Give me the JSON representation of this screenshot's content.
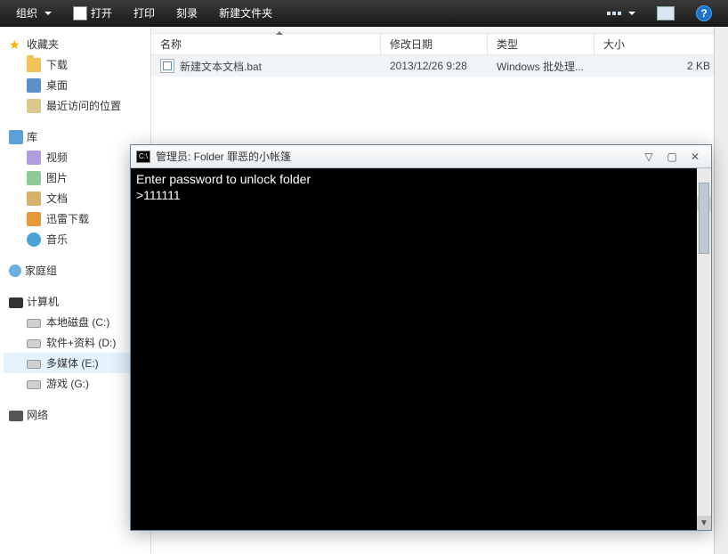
{
  "toolbar": {
    "organize": "组织",
    "open": "打开",
    "print": "打印",
    "burn": "刻录",
    "newfolder": "新建文件夹"
  },
  "sidebar": {
    "favorites": {
      "label": "收藏夹",
      "items": [
        {
          "label": "下载"
        },
        {
          "label": "桌面"
        },
        {
          "label": "最近访问的位置"
        }
      ]
    },
    "libraries": {
      "label": "库",
      "items": [
        {
          "label": "视频"
        },
        {
          "label": "图片"
        },
        {
          "label": "文档"
        },
        {
          "label": "迅雷下载"
        },
        {
          "label": "音乐"
        }
      ]
    },
    "homegroup": {
      "label": "家庭组"
    },
    "computer": {
      "label": "计算机",
      "items": [
        {
          "label": "本地磁盘 (C:)"
        },
        {
          "label": "软件+资料 (D:)"
        },
        {
          "label": "多媒体 (E:)"
        },
        {
          "label": "游戏 (G:)"
        }
      ]
    },
    "network": {
      "label": "网络"
    }
  },
  "columns": {
    "name": "名称",
    "date": "修改日期",
    "type": "类型",
    "size": "大小"
  },
  "files": [
    {
      "name": "新建文本文档.bat",
      "date": "2013/12/26 9:28",
      "type": "Windows 批处理...",
      "size": "2 KB"
    }
  ],
  "cmd": {
    "title": "管理员: Folder 罪恶的小帐篷",
    "line1": "Enter password to unlock folder",
    "line2": ">111111"
  }
}
